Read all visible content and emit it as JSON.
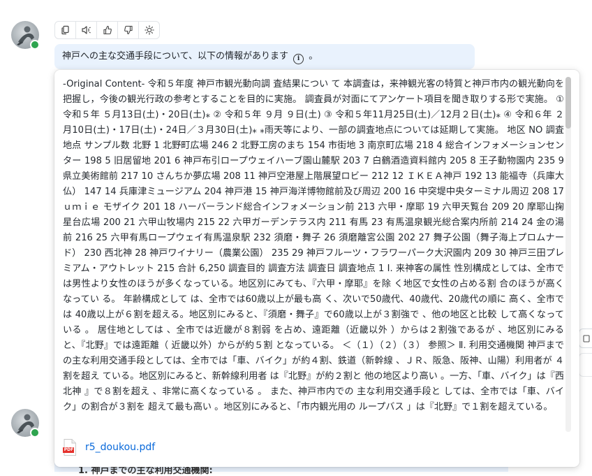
{
  "toolbar": {
    "icons": [
      "copy-icon",
      "speaker-icon",
      "thumbs-up-icon",
      "thumbs-down-icon",
      "sun-icon"
    ]
  },
  "message": {
    "text": "神戸への主な交通手段について、以下の情報があります",
    "info_icon_glyph": "i",
    "suffix": "。"
  },
  "popup": {
    "content": "-Original Content- 令和５年度 神戸市観光動向調 査結果につい て 本調査は，来神観光客の特質と神戸市内の観光動向を把握し，今後の観光行政の参考とすることを目的に実施。 調査員が対面にてアンケート項目を聞き取りする形で実施。 ① 令和５年 ５月13日(土)・20日(土)⁎ ② 令和５年 ９月 ９日(土) ③ 令和５年11月25日(土)／12月２日(土)⁎ ④ 令和６年 ２月10日(土)・17日(土)・24日／３月30日(土)⁎ ⁎雨天等により、一部の調査地点については延期して実施。 地区 NO 調査地点 サンプル数 北野 1 北野町広場 246 2 北野工房のまち 154 市街地 3 南京町広場 218 4 総合インフォメーションセンター 198 5 旧居留地 201 6 神戸布引ロープウェイハーブ園山麓駅 203 7 白鶴酒造資料館内 205 8 王子動物園内 235 9 県立美術館前 217 10 さんちか夢広場 208 11 神戸空港屋上階展望ロビー 212 12 ＩＫＥＡ神戸 192 13 能福寺（兵庫大仏） 147 14 兵庫津ミュージアム 204 神戸港 15 神戸海洋博物館前及び周辺 200 16 中突堤中央ターミナル周辺 208 17 ｕｍｉｅ モザイク 201 18 ハーバーランド総合インフォメーション前 213 六甲・摩耶 19 六甲天覧台 209 20 摩耶山掬星台広場 200 21 六甲山牧場内 215 22 六甲ガーデンテラス内 211 有馬 23 有馬温泉観光総合案内所前 214 24 金の湯前 216 25 六甲有馬ロープウェイ有馬温泉駅 232 須磨・舞子 26 須磨離宮公園 202 27 舞子公園（舞子海上プロムナード） 230 西北神 28 神戸ワイナリー（農業公園） 235 29 神戸フルーツ・フラワーパーク大沢園内 209 30 神戸三田プレミアム・アウトレット 215 合計 6,250 調査目的 調査方法 調査日 調査地点 1 Ⅰ. 来神客の属性 性別構成としては、全市では男性より女性のほうが多くなっている。地区別にみても、『六甲・摩耶』を除 く地区で女性の占める割 合のほうが高くなってい る。 年齢構成として は、全市では60歳以上が最も高 く、次いで50歳代、40歳代、20歳代の順に 高く、全市では 40歳以上が６割を超える。地区別にみると、『須磨・舞子』で60歳以上が３割強で 、他の地区と比較 して高くなっている 。 居住地としては 、全市では近畿が８割弱 を占め、遠距離（近畿以外 ）からは２割強であるが 、地区別にみる と、『北野』では遠距離（ 近畿以外）からが約５割 となっている。 ＜（１）（２）（３） 参照＞ Ⅱ. 利用交通機関 神戸までの主な利用交通手段としては、全市では「車、バイク」が約４割、鉄道（新幹線 、ＪＲ、阪急、阪神、山陽）利用者が ４割を超え ている。地区別にみると、新幹線利用者 は『北野』が約２割と 他の地区より高い 。一方、「車、バイク」は『西北神 』で８割を超え 、非常に高くなっている 。 また、神戸市内での 主な利用交通手段と しては、全市では「車、バイク」の割合が３割を 超えて最も高い 。地区別にみると、「市内観光用の ループバス 」は『北野』で１割を超えている。",
    "scrollbar_position": 0.0
  },
  "attachment": {
    "filename": "r5_doukou.pdf",
    "icon_label": "PDF"
  },
  "behind": {
    "list_item_text": "1. 神戸までの主な利用交通機関:"
  }
}
